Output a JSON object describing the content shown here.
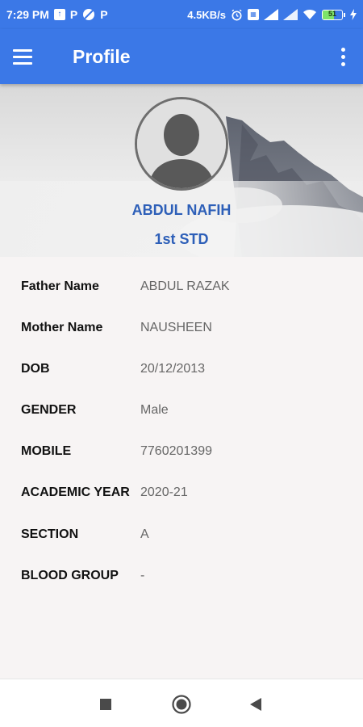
{
  "status_bar": {
    "time": "7:29 PM",
    "letter_1": "P",
    "letter_2": "P",
    "network_speed": "4.5KB/s",
    "battery_level": "51",
    "icons": [
      "upload-icon",
      "pinterest-icon",
      "blocked-icon",
      "alarm-icon",
      "sim-icon",
      "signal-icon",
      "wifi-icon",
      "battery-icon",
      "charging-icon"
    ]
  },
  "app_bar": {
    "title": "Profile",
    "menu_icon": "hamburger-menu-icon",
    "more_icon": "more-vertical-icon"
  },
  "profile": {
    "name": "ABDUL NAFIH",
    "class": "1st STD",
    "avatar_icon": "person-avatar-icon"
  },
  "details": [
    {
      "label": "Father Name",
      "value": "ABDUL RAZAK"
    },
    {
      "label": "Mother Name",
      "value": "NAUSHEEN"
    },
    {
      "label": "DOB",
      "value": "20/12/2013"
    },
    {
      "label": "GENDER",
      "value": "Male"
    },
    {
      "label": "MOBILE",
      "value": "7760201399"
    },
    {
      "label": "ACADEMIC YEAR",
      "value": "2020-21"
    },
    {
      "label": "SECTION",
      "value": "A"
    },
    {
      "label": "BLOOD GROUP",
      "value": "-"
    }
  ],
  "colors": {
    "primary": "#3b78e7",
    "name_text": "#2d5fb8",
    "label_text": "#111111",
    "value_text": "#666666",
    "background": "#f7f4f4"
  },
  "nav_bar": {
    "icons": [
      "recents-square-icon",
      "home-circle-icon",
      "back-triangle-icon"
    ]
  }
}
